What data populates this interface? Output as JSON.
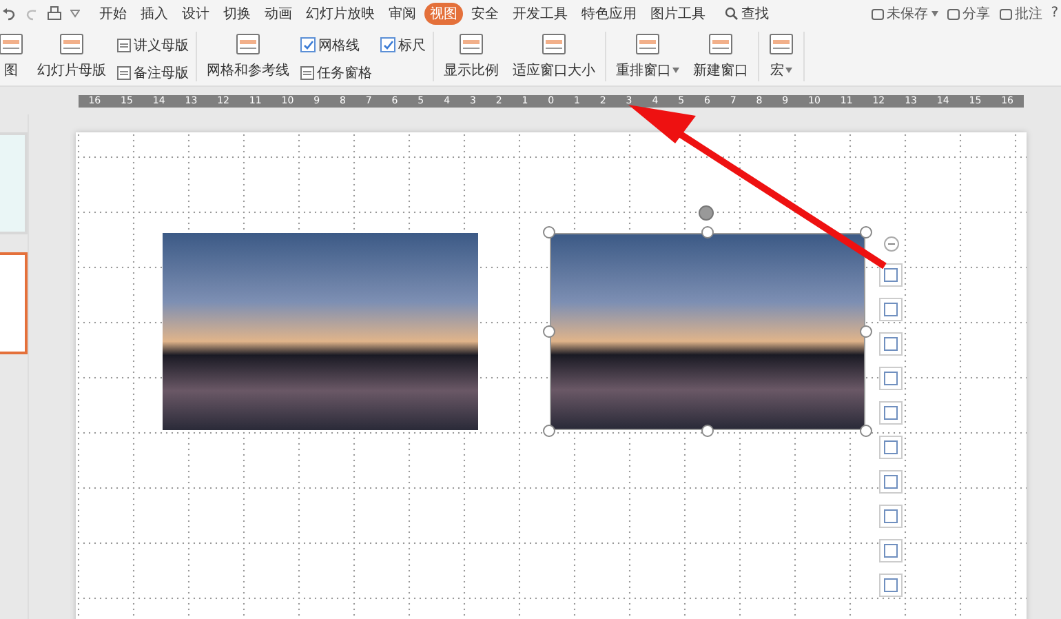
{
  "menu_tabs": [
    {
      "label": "开始",
      "selected": false
    },
    {
      "label": "插入",
      "selected": false
    },
    {
      "label": "设计",
      "selected": false
    },
    {
      "label": "切换",
      "selected": false
    },
    {
      "label": "动画",
      "selected": false
    },
    {
      "label": "幻灯片放映",
      "selected": false
    },
    {
      "label": "审阅",
      "selected": false
    },
    {
      "label": "视图",
      "selected": true
    },
    {
      "label": "安全",
      "selected": false
    },
    {
      "label": "开发工具",
      "selected": false
    },
    {
      "label": "特色应用",
      "selected": false
    },
    {
      "label": "图片工具",
      "selected": false
    }
  ],
  "search": {
    "label": "查找"
  },
  "right_actions": [
    {
      "label": "未保存",
      "dropdown": true
    },
    {
      "label": "分享",
      "dropdown": false
    },
    {
      "label": "批注",
      "dropdown": false
    }
  ],
  "help": "?",
  "ribbon_groups": [
    {
      "items": [
        {
          "kind": "large",
          "label": "图",
          "dropdown": false
        },
        {
          "kind": "large",
          "label": "幻灯片母版",
          "dropdown": false
        },
        {
          "kind": "stack",
          "items": [
            {
              "kind": "small",
              "label": "讲义母版"
            },
            {
              "kind": "small",
              "label": "备注母版"
            }
          ]
        }
      ]
    },
    {
      "items": [
        {
          "kind": "large",
          "label": "网格和参考线",
          "dropdown": false
        },
        {
          "kind": "stack",
          "items": [
            {
              "kind": "check",
              "label": "网格线",
              "checked": true
            },
            {
              "kind": "small",
              "label": "任务窗格"
            }
          ]
        },
        {
          "kind": "stack",
          "items": [
            {
              "kind": "check",
              "label": "标尺",
              "checked": true
            }
          ]
        }
      ]
    },
    {
      "items": [
        {
          "kind": "large",
          "label": "显示比例",
          "dropdown": false
        },
        {
          "kind": "large",
          "label": "适应窗口大小",
          "dropdown": false
        }
      ]
    },
    {
      "items": [
        {
          "kind": "large",
          "label": "重排窗口",
          "dropdown": true
        },
        {
          "kind": "large",
          "label": "新建窗口",
          "dropdown": false
        }
      ]
    },
    {
      "items": [
        {
          "kind": "large",
          "label": "宏",
          "dropdown": true
        }
      ]
    }
  ],
  "ruler": [
    "16",
    "15",
    "14",
    "13",
    "12",
    "11",
    "10",
    "9",
    "8",
    "7",
    "6",
    "5",
    "4",
    "3",
    "2",
    "1",
    "0",
    "1",
    "2",
    "3",
    "4",
    "5",
    "6",
    "7",
    "8",
    "9",
    "10",
    "11",
    "12",
    "13",
    "14",
    "15",
    "16"
  ],
  "slides": [
    {
      "selected": false
    },
    {
      "selected": true
    }
  ],
  "pictures": [
    {
      "selected": false
    },
    {
      "selected": true
    }
  ]
}
